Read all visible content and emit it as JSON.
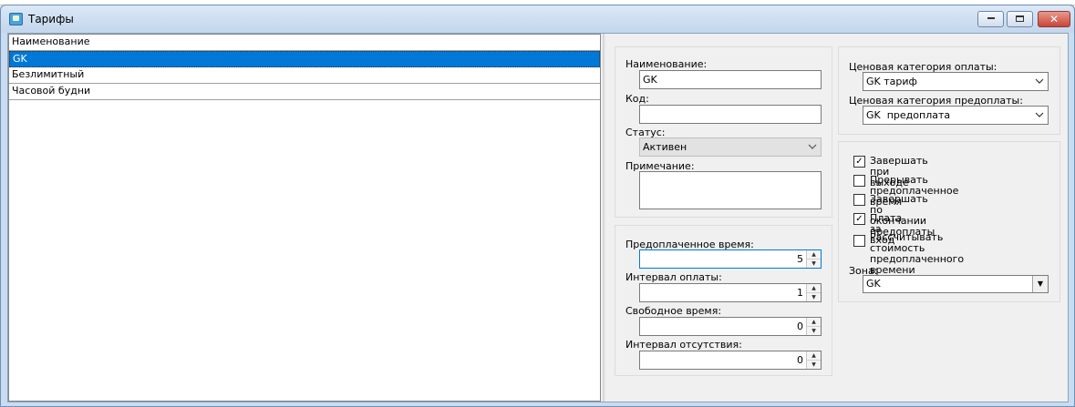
{
  "window": {
    "title": "Тарифы"
  },
  "tariffs": {
    "items": [
      {
        "label": "Наименование",
        "selected": false
      },
      {
        "label": "GK",
        "selected": true
      },
      {
        "label": "Безлимитный",
        "selected": false
      },
      {
        "label": "Часовой будни",
        "selected": false
      }
    ]
  },
  "details": {
    "name_label": "Наименование:",
    "name_value": "GK",
    "code_label": "Код:",
    "code_value": "",
    "status_label": "Статус:",
    "status_value": "Активен",
    "note_label": "Примечание:",
    "note_value": ""
  },
  "timing": {
    "prepaid_label": "Предоплаченное время:",
    "prepaid_value": "5",
    "interval_label": "Интервал оплаты:",
    "interval_value": "1",
    "free_label": "Свободное время:",
    "free_value": "0",
    "absence_label": "Интервал отсутствия:",
    "absence_value": "0"
  },
  "pricing": {
    "payment_category_label": "Ценовая категория оплаты:",
    "payment_category_value": "GK тариф",
    "prepay_category_label": "Ценовая категория предоплаты:",
    "prepay_category_value": "GK  предоплата"
  },
  "options": {
    "items": [
      {
        "label": "Завершать при выходе",
        "checked": true
      },
      {
        "label": "Прерывать предоплаченное время",
        "checked": false
      },
      {
        "label": "Завершать по окончании предоплаты",
        "checked": false
      },
      {
        "label": "Плата за вход",
        "checked": true
      },
      {
        "label": "Рассчитывать стоимость\nпредоплаченного времени",
        "checked": false
      }
    ],
    "zone_label": "Зона:",
    "zone_value": "GK"
  },
  "colors": {
    "selection": "#0078d7",
    "window_frame": "#c9dcf0"
  }
}
